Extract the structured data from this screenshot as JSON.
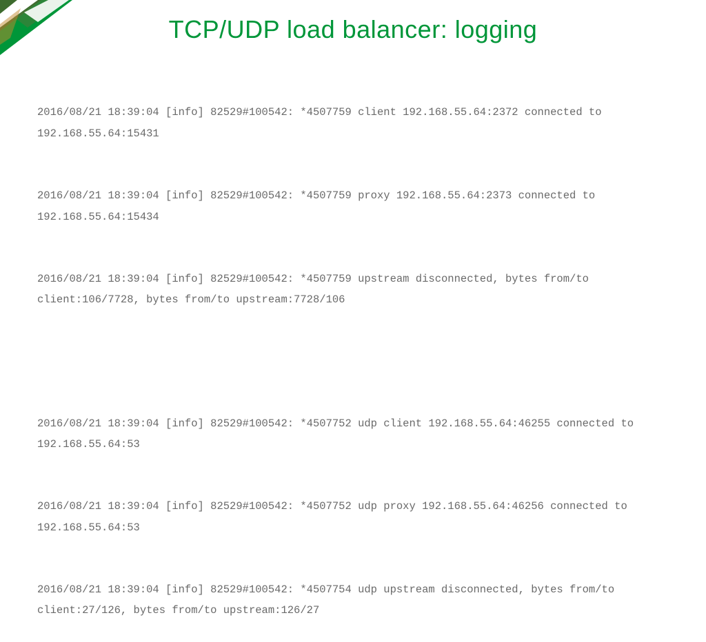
{
  "title": "TCP/UDP load balancer: logging",
  "colors": {
    "accent": "#009639",
    "text": "#6a6a6a"
  },
  "logs": {
    "group1": [
      "2016/08/21 18:39:04 [info] 82529#100542: *4507759 client 192.168.55.64:2372 connected to 192.168.55.64:15431",
      "2016/08/21 18:39:04 [info] 82529#100542: *4507759 proxy 192.168.55.64:2373 connected to 192.168.55.64:15434",
      "2016/08/21 18:39:04 [info] 82529#100542: *4507759 upstream disconnected, bytes from/to client:106/7728, bytes from/to upstream:7728/106"
    ],
    "group2": [
      "2016/08/21 18:39:04 [info] 82529#100542: *4507752 udp client 192.168.55.64:46255 connected to 192.168.55.64:53",
      "2016/08/21 18:39:04 [info] 82529#100542: *4507752 udp proxy 192.168.55.64:46256 connected to 192.168.55.64:53",
      "2016/08/21 18:39:04 [info] 82529#100542: *4507754 udp upstream disconnected, bytes from/to client:27/126, bytes from/to upstream:126/27"
    ]
  }
}
